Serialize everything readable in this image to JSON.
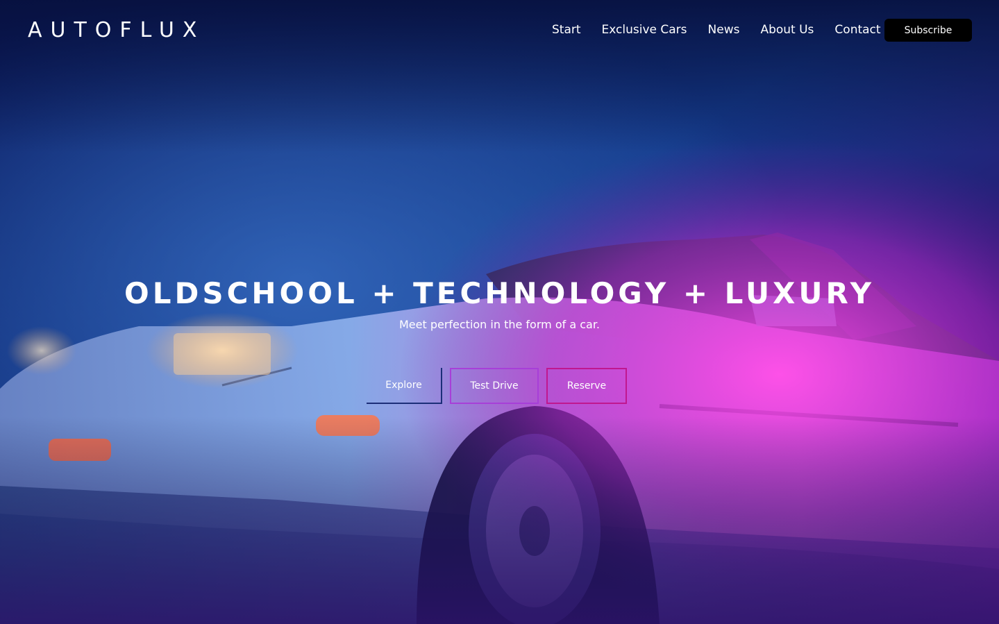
{
  "brand": {
    "logo": "AUTOFLUX"
  },
  "nav": {
    "items": [
      "Start",
      "Exclusive Cars",
      "News",
      "About Us",
      "Contact"
    ],
    "subscribe_label": "Subscribe"
  },
  "hero": {
    "headline": "OLDSCHOOL + TECHNOLOGY + LUXURY",
    "subline": "Meet perfection in the form of a car.",
    "buttons": {
      "explore": "Explore",
      "test_drive": "Test Drive",
      "reserve": "Reserve"
    },
    "background_image": "retro-sports-car-night",
    "colors": {
      "deep_blue": "#0b1347",
      "glow_blue": "#2f6fd6",
      "magenta": "#c43ad8",
      "purple": "#5a1a9c"
    }
  }
}
